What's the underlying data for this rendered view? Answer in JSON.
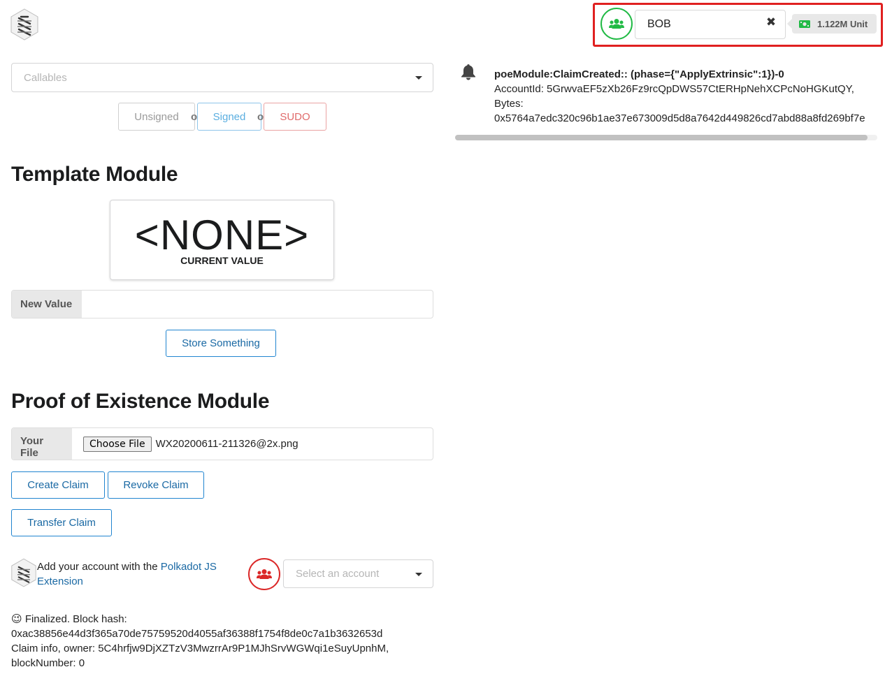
{
  "header": {
    "account_name": "BOB",
    "balance": "1.122M Unit",
    "colors": {
      "account_green": "#21ba45",
      "highlight_red": "#e02020"
    }
  },
  "callables": {
    "placeholder": "Callables"
  },
  "sign_buttons": {
    "unsigned": "Unsigned",
    "or1": "or",
    "signed": "Signed",
    "or2": "or",
    "sudo": "SUDO"
  },
  "template_module": {
    "title": "Template Module",
    "current_value": "<NONE>",
    "current_value_label": "CURRENT VALUE",
    "new_value_label": "New Value",
    "new_value": "",
    "store_button": "Store Something"
  },
  "poe_module": {
    "title": "Proof of Existence Module",
    "file_label": "Your File",
    "choose_file_button": "Choose File",
    "file_name": "WX20200611-211326@2x.png",
    "create_claim": "Create Claim",
    "revoke_claim": "Revoke Claim",
    "transfer_claim": "Transfer Claim"
  },
  "account_prompt": {
    "text_before": "Add your account with the ",
    "link_text_1": "Polkadot JS",
    "link_text_2": "Extension",
    "select_placeholder": "Select an account"
  },
  "status": {
    "emoji": "😉",
    "line1": "Finalized. Block hash:",
    "line2": "0xac38856e44d3f365a70de75759520d4055af36388f1754f8de0c7a1b3632653d",
    "line3": "Claim info, owner: 5C4hrfjw9DjXZTzV3MwzrrAr9P1MJhSrvWGWqi1eSuyUpnhM,",
    "line4": "blockNumber: 0"
  },
  "events": {
    "title": "poeModule:ClaimCreated:: (phase={\"ApplyExtrinsic\":1})-0",
    "line1": "AccountId: 5GrwvaEF5zXb26Fz9rcQpDWS57CtERHpNehXCPcNoHGKutQY,",
    "line2": "Bytes:",
    "line3": "0x5764a7edc320c96b1ae37e673009d5d8a7642d449826cd7abd88a8fd269bf7e"
  }
}
